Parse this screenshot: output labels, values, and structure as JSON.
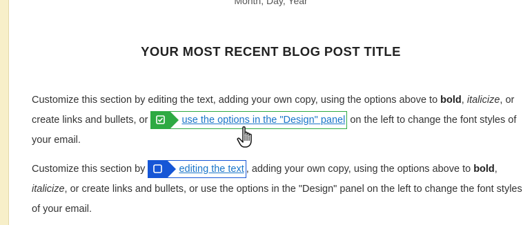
{
  "header": {
    "date_line": "Month, Day, Year",
    "post_title": "YOUR MOST RECENT BLOG POST TITLE"
  },
  "paragraph1": {
    "text_a": "Customize this section by editing the text, adding your own copy, using the options above to ",
    "bold": "bold",
    "text_b": ", ",
    "italic": "italicize",
    "text_c": ", or create links and bullets, or ",
    "link": "use the options in the \"Design\" panel",
    "text_d": " on the left to change the font styles of your email."
  },
  "paragraph2": {
    "text_a": "Customize this section by ",
    "link": "editing the text",
    "text_b": ", adding your own copy, using the options above to ",
    "bold": "bold",
    "text_c": ", ",
    "italic": "italicize",
    "text_d": ", or create links and bullets, or use the options in the \"Design\" panel on the left to change the font styles of your email."
  },
  "colors": {
    "selected_link_tag": "#2eaa43",
    "link_tag": "#1656d6",
    "link_text": "#1a75c9"
  },
  "icons": {
    "selected_tag_icon": "checkbox-checked-icon",
    "link_tag_icon": "checkbox-empty-icon",
    "cursor": "hand-pointer-icon"
  }
}
